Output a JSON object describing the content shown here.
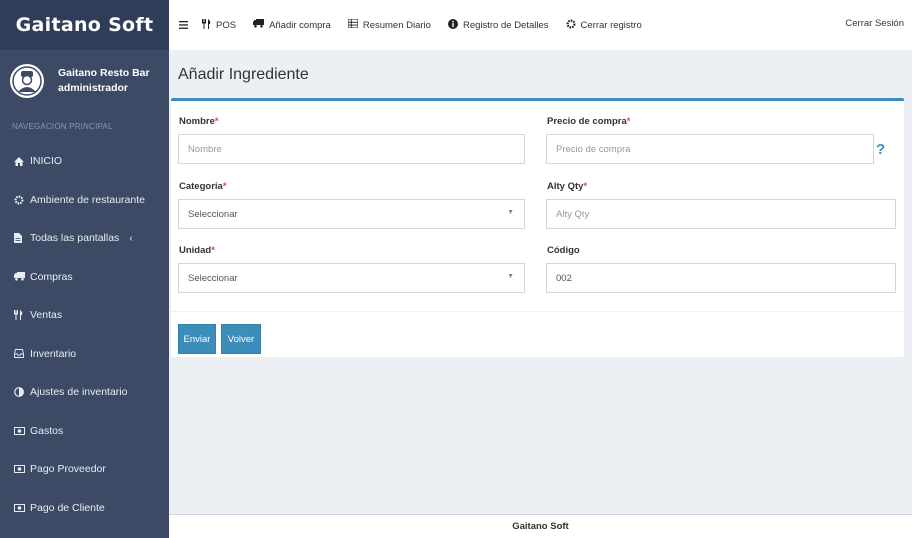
{
  "brand": "Gaitano Soft",
  "user": {
    "name": "Gaitano Resto Bar",
    "role": "administrador"
  },
  "sidebar": {
    "header": "NAVEGACIÓN PRINCIPAL",
    "items": [
      {
        "label": "INICIO",
        "icon": "home-icon"
      },
      {
        "label": "Ambiente de restaurante",
        "icon": "gear-icon"
      },
      {
        "label": "Todas las pantallas",
        "icon": "file-icon",
        "chevron": "‹"
      },
      {
        "label": "Compras",
        "icon": "truck-icon"
      },
      {
        "label": "Ventas",
        "icon": "cutlery-icon"
      },
      {
        "label": "Inventario",
        "icon": "inbox-icon"
      },
      {
        "label": "Ajustes de inventario",
        "icon": "adjust-icon"
      },
      {
        "label": "Gastos",
        "icon": "money-icon"
      },
      {
        "label": "Pago Proveedor",
        "icon": "money-icon"
      },
      {
        "label": "Pago de Cliente",
        "icon": "money-icon"
      }
    ]
  },
  "topbar": {
    "items": [
      {
        "label": "POS",
        "icon": "cutlery-icon"
      },
      {
        "label": "Añadir compra",
        "icon": "truck-icon"
      },
      {
        "label": "Resumen Diario",
        "icon": "list-icon"
      },
      {
        "label": "Registro de Detalles",
        "icon": "info-icon"
      },
      {
        "label": "Cerrar registro",
        "icon": "gear-icon"
      }
    ],
    "logout": "Cerrar Sesión"
  },
  "page": {
    "title": "Añadir Ingrediente"
  },
  "form": {
    "nombre": {
      "label": "Nombre",
      "required": "*",
      "placeholder": "Nombre"
    },
    "precio": {
      "label": "Precio de compra",
      "required": "*",
      "placeholder": "Precio de compra",
      "help": "?"
    },
    "categoria": {
      "label": "Categoría",
      "required": "*",
      "value": "Seleccionar"
    },
    "alty": {
      "label": "Alty Qty",
      "required": "*",
      "placeholder": "Alty Qty"
    },
    "unidad": {
      "label": "Unidad",
      "required": "*",
      "value": "Seleccionar"
    },
    "codigo": {
      "label": "Código",
      "value": "002"
    },
    "submit": "Enviar",
    "back": "Volver"
  },
  "footer": "Gaitano Soft",
  "colors": {
    "sidebar": "#3c4a66",
    "accent": "#3c8dbc",
    "required": "#dd4b39"
  }
}
